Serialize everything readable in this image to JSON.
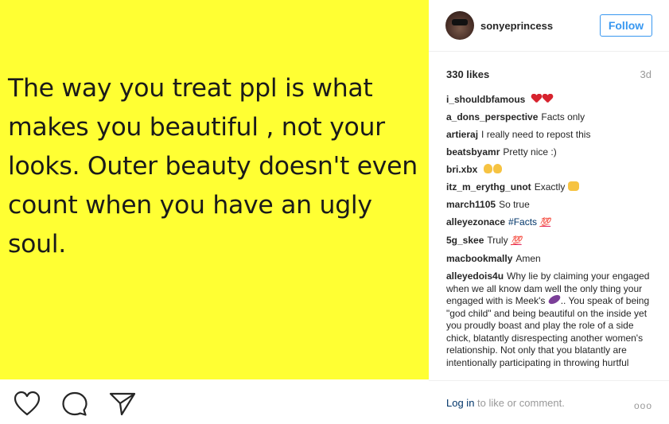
{
  "post": {
    "quote": "The way you treat ppl is what\nmakes you beautiful , not your\nlooks. Outer beauty doesn't even\ncount when you have an ugly\nsoul."
  },
  "header": {
    "username": "sonyeprincess",
    "follow_label": "Follow"
  },
  "stats": {
    "likes": "330 likes",
    "age": "3d"
  },
  "comments": [
    {
      "user": "i_shouldbfamous",
      "text": ""
    },
    {
      "user": "a_dons_perspective",
      "text": "Facts only"
    },
    {
      "user": "artieraj",
      "text": "I really need to repost this"
    },
    {
      "user": "beatsbyamr",
      "text": "Pretty nice :)"
    },
    {
      "user": "bri.xbx",
      "text": ""
    },
    {
      "user": "itz_m_erythg_unot",
      "text": "Exactly"
    },
    {
      "user": "march1105",
      "text": "So true"
    },
    {
      "user": "alleyezonace",
      "text": "#Facts"
    },
    {
      "user": "5g_skee",
      "text": "Truly"
    },
    {
      "user": "macbookmally",
      "text": "Amen"
    },
    {
      "user": "alleyedois4u",
      "text": "Why lie by claiming your engaged when we all know dam well the only thing your engaged with is Meek's",
      "text2": ".. You speak of being \"god child\" and being beautiful on the inside yet you proudly boast and play the role of a side chick, blatantly disrespecting another women's relationship. Not only that you blatantly are intentionally participating in throwing hurtful"
    }
  ],
  "emoji": {
    "hundred": "💯"
  },
  "footer": {
    "login_link": "Log in",
    "login_rest": " to like or comment.",
    "more": "ooo"
  },
  "icons": [
    "heart-icon",
    "comment-icon",
    "share-icon",
    "more-options-icon"
  ],
  "colors": {
    "photo_bg": "#ffff33",
    "link_blue": "#3897f0",
    "muted": "#999999"
  }
}
